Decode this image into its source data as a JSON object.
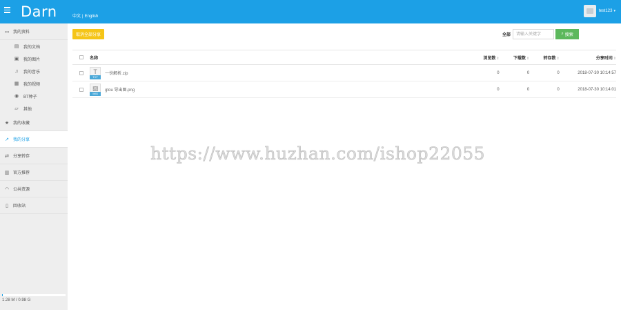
{
  "header": {
    "logo": "Darn",
    "lang_zh": "中文",
    "lang_sep": "|",
    "lang_en": "English",
    "username": "test123"
  },
  "sidebar": {
    "items": [
      {
        "label": "我的资料",
        "icon": "folder-icon",
        "sub": false,
        "active": false
      },
      {
        "label": "我的文档",
        "icon": "document-icon",
        "sub": true,
        "active": false
      },
      {
        "label": "我的图片",
        "icon": "image-icon",
        "sub": true,
        "active": false
      },
      {
        "label": "我的音乐",
        "icon": "music-icon",
        "sub": true,
        "active": false
      },
      {
        "label": "我的视频",
        "icon": "video-icon",
        "sub": true,
        "active": false
      },
      {
        "label": "BT种子",
        "icon": "torrent-icon",
        "sub": true,
        "active": false
      },
      {
        "label": "其他",
        "icon": "folder-open-icon",
        "sub": true,
        "active": false
      },
      {
        "label": "我的收藏",
        "icon": "star-icon",
        "sub": false,
        "active": false
      },
      {
        "label": "我的分享",
        "icon": "share-icon",
        "sub": false,
        "active": true
      },
      {
        "label": "分享转存",
        "icon": "transfer-icon",
        "sub": false,
        "active": false
      },
      {
        "label": "官方推荐",
        "icon": "recommend-icon",
        "sub": false,
        "active": false
      },
      {
        "label": "公共资源",
        "icon": "rss-icon",
        "sub": false,
        "active": false
      },
      {
        "label": "回收站",
        "icon": "trash-icon",
        "sub": false,
        "active": false
      }
    ],
    "storage_text": "1.28 M / 0.98 G",
    "storage_fraction": 0.0013
  },
  "toolbar": {
    "upload_label": "取消全部分享",
    "search_scope": "全部",
    "search_placeholder": "请输入关键字",
    "search_button": "搜索"
  },
  "table": {
    "columns": {
      "name": "名称",
      "views": "浏览数",
      "downloads": "下载数",
      "saves": "转存数",
      "time": "分享时间"
    },
    "rows": [
      {
        "name": "一份解析.zip",
        "icon": "text-file-icon",
        "tag": "TXT",
        "views": "0",
        "downloads": "0",
        "saves": "0",
        "time": "2018-07-30 10:14:57"
      },
      {
        "name": "gtou 导出图.png",
        "icon": "image-file-icon",
        "tag": "IMG",
        "views": "0",
        "downloads": "0",
        "saves": "0",
        "time": "2018-07-30 10:14:01"
      }
    ]
  },
  "watermark": "https://www.huzhan.com/ishop22055"
}
